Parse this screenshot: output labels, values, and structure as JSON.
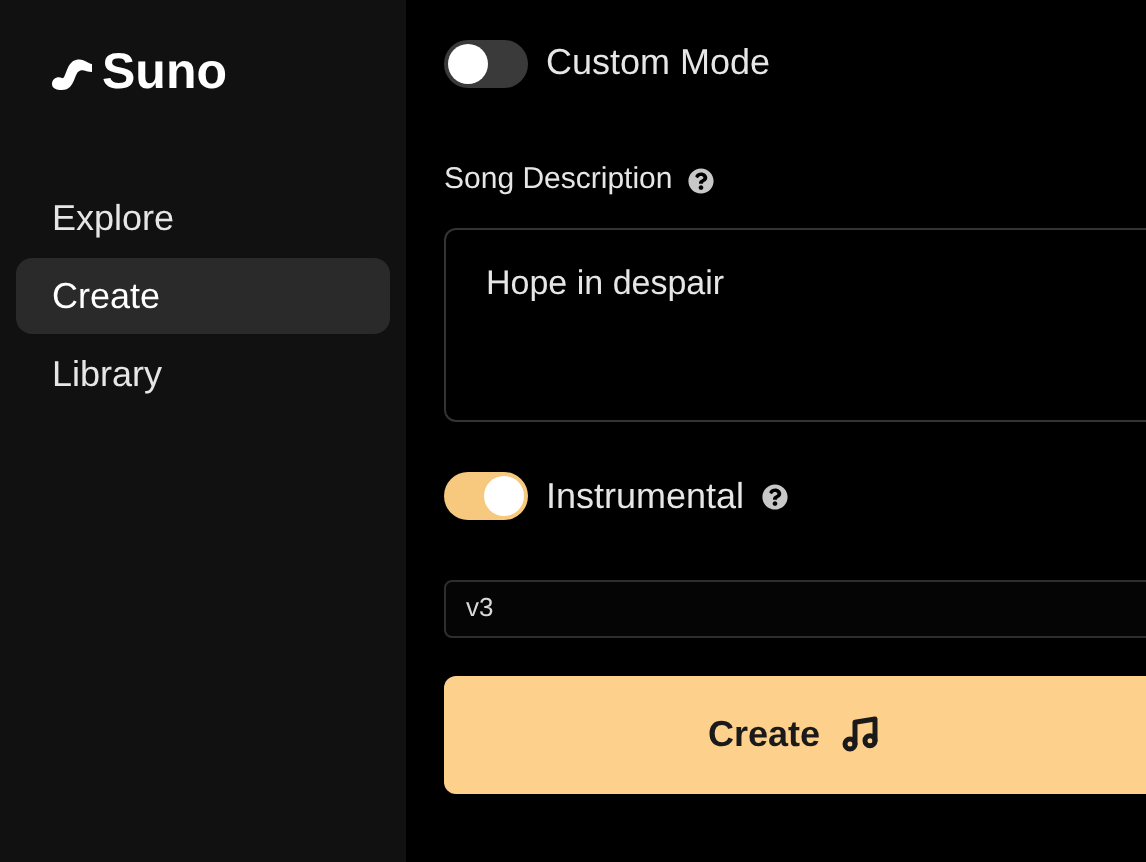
{
  "sidebar": {
    "logo": "Suno",
    "items": [
      {
        "label": "Explore",
        "selected": false
      },
      {
        "label": "Create",
        "selected": true
      },
      {
        "label": "Library",
        "selected": false
      }
    ]
  },
  "form": {
    "custom_mode": {
      "label": "Custom Mode",
      "on": false
    },
    "description": {
      "label": "Song Description",
      "value": "Hope in despair"
    },
    "instrumental": {
      "label": "Instrumental",
      "on": true
    },
    "model": {
      "value": "v3"
    },
    "create_button": {
      "label": "Create"
    }
  }
}
